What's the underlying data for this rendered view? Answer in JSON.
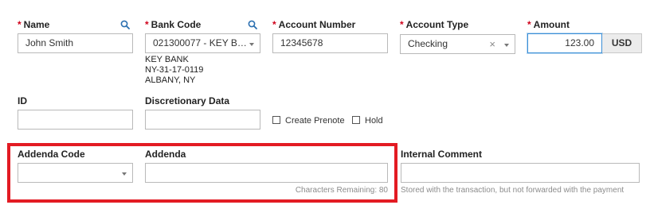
{
  "fields": {
    "name": {
      "label": "Name",
      "value": "John Smith"
    },
    "bank_code": {
      "label": "Bank Code",
      "value": "021300077 - KEY B…",
      "info": [
        "KEY BANK",
        "NY-31-17-0119",
        "ALBANY, NY"
      ]
    },
    "account_number": {
      "label": "Account Number",
      "value": "12345678"
    },
    "account_type": {
      "label": "Account Type",
      "value": "Checking",
      "clear_glyph": "×"
    },
    "amount": {
      "label": "Amount",
      "value": "123.00",
      "currency": "USD"
    },
    "id": {
      "label": "ID",
      "value": ""
    },
    "discretionary_data": {
      "label": "Discretionary Data",
      "value": ""
    },
    "create_prenote": {
      "label": "Create Prenote",
      "checked": false
    },
    "hold": {
      "label": "Hold",
      "checked": false
    },
    "addenda_code": {
      "label": "Addenda Code",
      "value": ""
    },
    "addenda": {
      "label": "Addenda",
      "value": "",
      "chars_remaining": "Characters Remaining: 80"
    },
    "internal_comment": {
      "label": "Internal Comment",
      "value": "",
      "hint": "Stored with the transaction, but not forwarded with the payment"
    }
  },
  "required_marker": "*",
  "icons": {
    "lookup": "search-icon",
    "dropdown": "chevron-down-icon",
    "clear": "close-icon"
  },
  "colors": {
    "required": "#d0021b",
    "highlight": "#e31b23",
    "focus": "#3b8fd6",
    "lookup_icon": "#2a6fb0"
  }
}
